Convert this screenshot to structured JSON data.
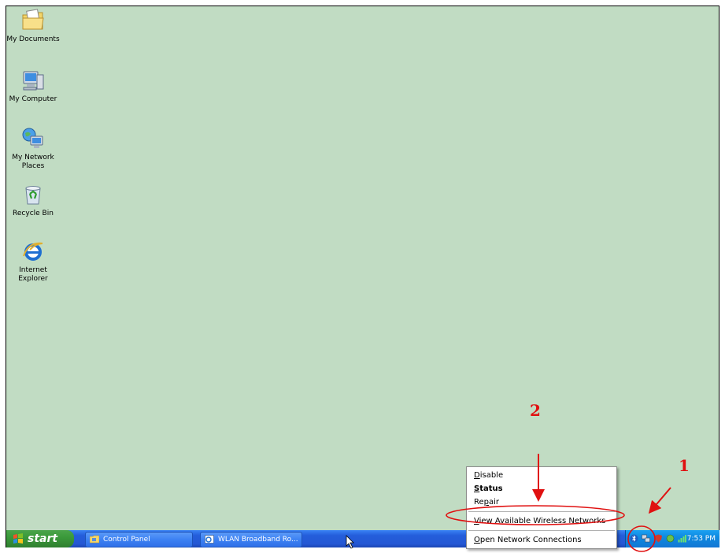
{
  "desktop_icons": [
    {
      "label": "My Documents",
      "icon": "folder-documents-icon"
    },
    {
      "label": "My Computer",
      "icon": "computer-icon"
    },
    {
      "label": "My Network\nPlaces",
      "icon": "network-places-icon"
    },
    {
      "label": "Recycle Bin",
      "icon": "recycle-bin-icon"
    },
    {
      "label": "Internet\nExplorer",
      "icon": "internet-explorer-icon"
    }
  ],
  "context_menu": {
    "disable": {
      "pre": "",
      "u": "D",
      "post": "isable"
    },
    "status": {
      "pre": "",
      "u": "S",
      "post": "tatus"
    },
    "repair": {
      "pre": "Re",
      "u": "p",
      "post": "air"
    },
    "view_wireless": {
      "pre": "",
      "u": "V",
      "post": "iew Available Wireless Networks"
    },
    "open_connections": {
      "pre": "",
      "u": "O",
      "post": "pen Network Connections"
    }
  },
  "taskbar": {
    "start_label": "start",
    "buttons": [
      "Control Panel",
      "WLAN Broadband Ro..."
    ],
    "clock": "7:53 PM"
  },
  "annotations": {
    "step1": "1",
    "step2": "2"
  },
  "colors": {
    "desktop": "#c1dcc3",
    "taskbar": "#245edb",
    "start": "#3b9a3b",
    "annotation": "#e01010"
  }
}
